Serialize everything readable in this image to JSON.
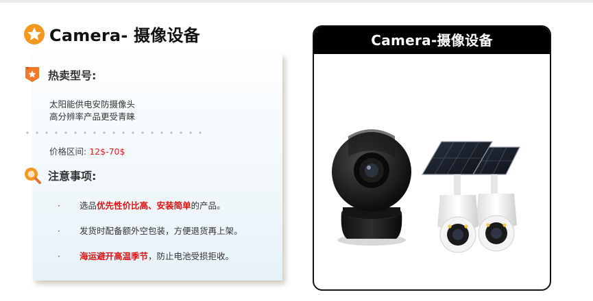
{
  "page": {
    "title": "Camera- 摄像设备"
  },
  "hot_models": {
    "heading": "热卖型号:",
    "lines": [
      "太阳能供电安防摄像头",
      "高分辨率产品更受青睐"
    ],
    "price_label": "价格区间:",
    "price_value": "12$-70$"
  },
  "notes": {
    "heading": "注意事项:",
    "bullet_marker": "·",
    "items": [
      {
        "pre": "选品",
        "highlight": "优先性价比高、安装简单",
        "post": "的产品。"
      },
      {
        "pre": "发货时配备额外空包装，方便退货再上架。",
        "highlight": "",
        "post": ""
      },
      {
        "pre": "",
        "highlight": "海运避开高温季节",
        "post": "，防止电池受损拒收。"
      }
    ]
  },
  "product_panel": {
    "header": "Camera-摄像设备"
  },
  "icons": {
    "title": "star-icon",
    "hot_models": "ribbon-badge-icon",
    "notes": "search-icon"
  },
  "colors": {
    "accent_orange": "#f5961e",
    "highlight_red": "#e01010",
    "price_red": "#e02020",
    "panel_header_bg": "#000000"
  }
}
